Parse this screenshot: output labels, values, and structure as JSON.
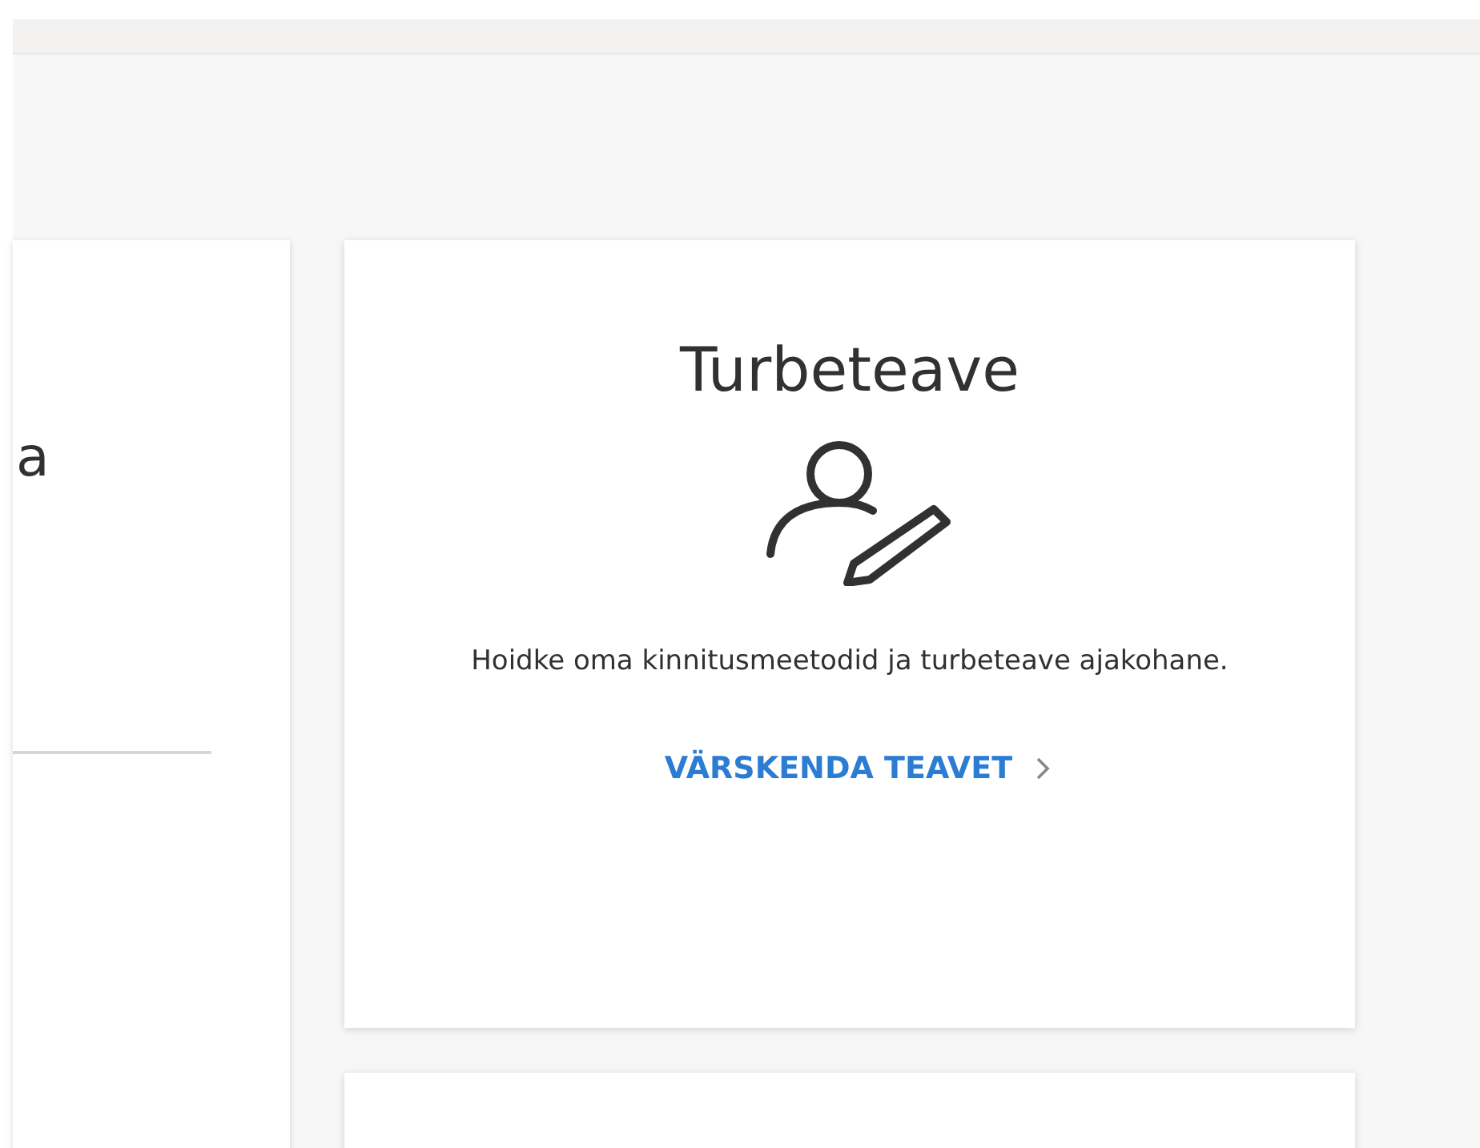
{
  "left_card": {
    "title": "a"
  },
  "security_card": {
    "title": "Turbeteave",
    "description": "Hoidke oma kinnitusmeetodid ja turbeteave ajakohane.",
    "link": "VÄRSKENDA TEAVET"
  }
}
